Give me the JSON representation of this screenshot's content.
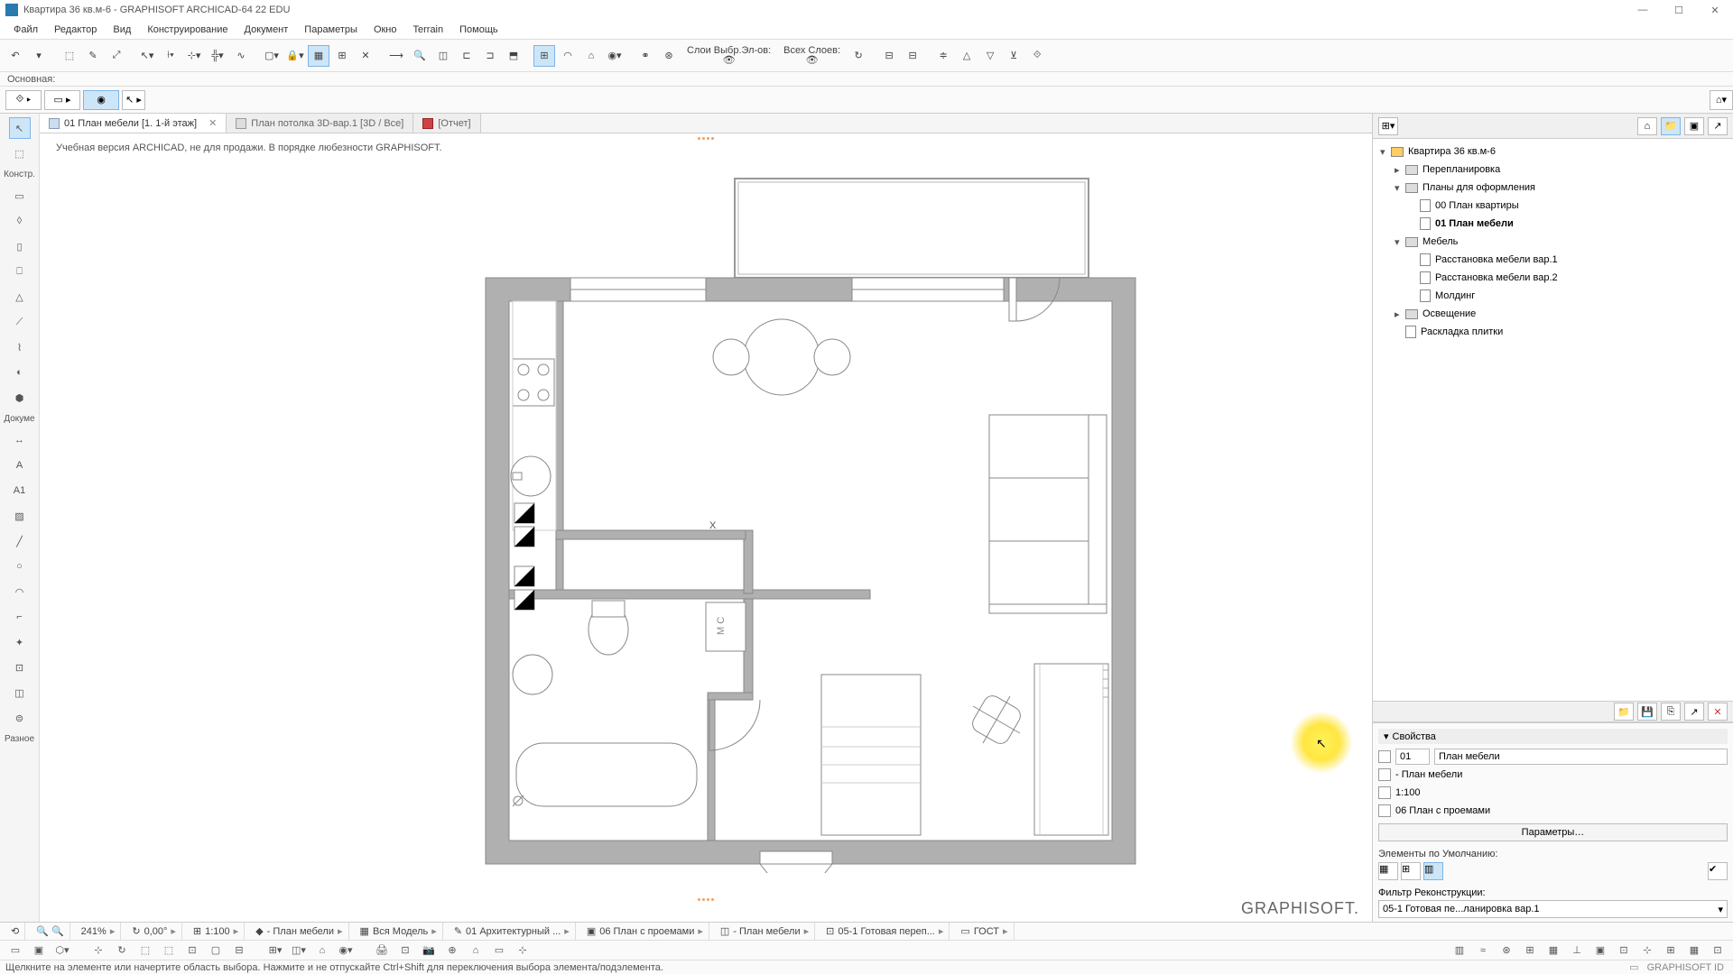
{
  "window": {
    "title": "Квартира 36 кв.м-6 - GRAPHISOFT ARCHICAD-64 22 EDU"
  },
  "menu": [
    "Файл",
    "Редактор",
    "Вид",
    "Конструирование",
    "Документ",
    "Параметры",
    "Окно",
    "Terrain",
    "Помощь"
  ],
  "toolbar_labels": {
    "selection": {
      "line1": "Слои Выбр.Эл-ов:",
      "line2": ""
    },
    "layers": {
      "line1": "Всех Слоев:",
      "line2": ""
    }
  },
  "context_label": "Основная:",
  "tabs": [
    {
      "label": "01 План мебели [1. 1-й этаж]",
      "active": true
    },
    {
      "label": "План потолка 3D-вар.1 [3D / Все]",
      "active": false
    },
    {
      "label": "[Отчет]",
      "active": false
    }
  ],
  "watermark_text": "Учебная версия ARCHICAD, не для продажи. В порядке любезности GRAPHISOFT.",
  "brand": "GRAPHISOFT.",
  "plan_marker": "X",
  "tree": {
    "root": "Квартира 36 кв.м-6",
    "items": [
      {
        "label": "Перепланировка",
        "indent": 1,
        "icon": "folder"
      },
      {
        "label": "Планы для оформления",
        "indent": 1,
        "icon": "folder",
        "expanded": true
      },
      {
        "label": "00 План квартиры",
        "indent": 2,
        "icon": "page"
      },
      {
        "label": "01 План мебели",
        "indent": 2,
        "icon": "page",
        "selected": true
      },
      {
        "label": "Мебель",
        "indent": 1,
        "icon": "folder",
        "expanded": true
      },
      {
        "label": "Расстановка мебели вар.1",
        "indent": 2,
        "icon": "page"
      },
      {
        "label": "Расстановка мебели вар.2",
        "indent": 2,
        "icon": "page"
      },
      {
        "label": "Молдинг",
        "indent": 2,
        "icon": "page"
      },
      {
        "label": "Освещение",
        "indent": 1,
        "icon": "folder"
      },
      {
        "label": "Раскладка плитки",
        "indent": 1,
        "icon": "page"
      }
    ]
  },
  "properties": {
    "title": "Свойства",
    "id": "01",
    "name": "План мебели",
    "layer_combo": "- План мебели",
    "scale": "1:100",
    "structure": "06 План с проемами",
    "params_btn": "Параметры…",
    "defaults_label": "Элементы по Умолчанию:",
    "filter_label": "Фильтр Реконструкции:",
    "filter_value": "05-1 Готовая пе...ланировка вар.1"
  },
  "statusbar": {
    "zoom": "241%",
    "angle": "0,00°",
    "scale": "1:100",
    "layer_combo": "- План мебели",
    "model_view": "Вся Модель",
    "pen_set": "01 Архитектурный ...",
    "structure_display": "06 План с проемами",
    "graphic_override": "- План мебели",
    "renovation": "05-1 Готовая переп...",
    "standard": "ГОСТ"
  },
  "hint": "Щелкните на элементе или начертите область выбора. Нажмите и не отпускайте Ctrl+Shift для переключения выбора элемента/подэлемента.",
  "footer_brand": "GRAPHISOFT ID",
  "left_toolbox_groups": [
    "Констр.",
    "Докуме",
    "Разное"
  ]
}
